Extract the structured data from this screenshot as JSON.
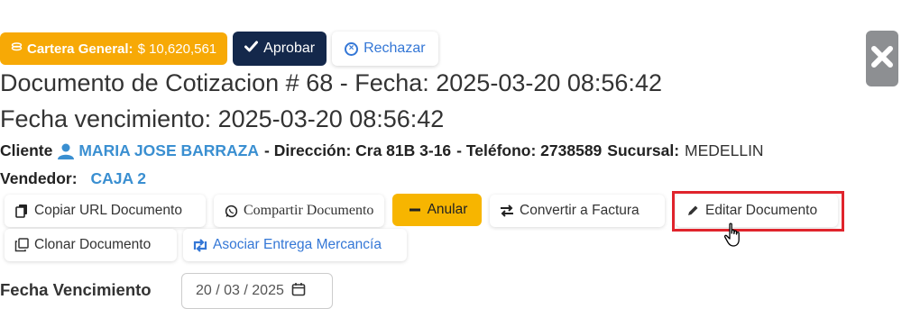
{
  "top_actions": {
    "cartera_label": "Cartera General:",
    "cartera_value": "$ 10,620,561",
    "cartera_icon": "money-icon",
    "aprobar_label": "Aprobar",
    "rechazar_label": "Rechazar"
  },
  "document": {
    "title": "Documento de Cotizacion # 68 - Fecha: 2025-03-20 08:56:42",
    "vencimiento": "Fecha vencimiento: 2025-03-20 08:56:42"
  },
  "client": {
    "cliente_label": "Cliente",
    "cliente_name": "MARIA JOSE BARRAZA",
    "direccion_label": "- Dirección: Cra 81B 3-16",
    "telefono_label": "- Teléfono: 2738589",
    "sucursal_label": "Sucursal:",
    "sucursal_value": "MEDELLIN",
    "vendedor_label": "Vendedor:",
    "vendedor_value": "CAJA 2"
  },
  "actions": {
    "copiar": "Copiar URL Documento",
    "compartir": "Compartir Documento",
    "anular": "Anular",
    "convertir": "Convertir a Factura",
    "editar": "Editar Documento",
    "clonar": "Clonar Documento",
    "asociar": "Asociar Entrega Mercancía"
  },
  "fecha_vencimiento": {
    "label": "Fecha Vencimiento",
    "value": "20 / 03 / 2025"
  },
  "colors": {
    "warning": "#f7a906",
    "primary_dark": "#14284b",
    "link": "#3a8fd1",
    "highlight": "#e0242c"
  }
}
